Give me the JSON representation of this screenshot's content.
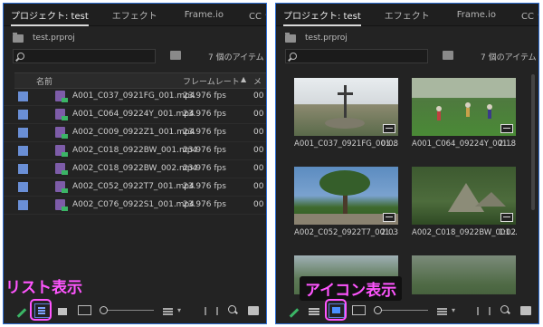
{
  "tabs": {
    "project": "プロジェクト: test",
    "effects": "エフェクト",
    "frameio": "Frame.io",
    "cclib": "CC ライ"
  },
  "project_file": "test.prproj",
  "search": {
    "placeholder": ""
  },
  "item_count": "7 個のアイテム",
  "list_view": {
    "columns": {
      "name": "名前",
      "framerate": "フレームレート",
      "extra": "メ"
    },
    "rows": [
      {
        "name": "A001_C037_0921FG_001.mp4",
        "fps": "23.976 fps",
        "extra": "00"
      },
      {
        "name": "A001_C064_09224Y_001.mp4",
        "fps": "23.976 fps",
        "extra": "00"
      },
      {
        "name": "A002_C009_0922Z1_001.mp4",
        "fps": "23.976 fps",
        "extra": "00"
      },
      {
        "name": "A002_C018_0922BW_001.mp4",
        "fps": "23.976 fps",
        "extra": "00"
      },
      {
        "name": "A002_C018_0922BW_002.mp4",
        "fps": "23.976 fps",
        "extra": "00"
      },
      {
        "name": "A002_C052_0922T7_001.mp4",
        "fps": "23.976 fps",
        "extra": "00"
      },
      {
        "name": "A002_C076_0922S1_001.mp4",
        "fps": "23.976 fps",
        "extra": "00"
      }
    ]
  },
  "icon_view": {
    "clips": [
      {
        "name": "A001_C037_0921FG_001...",
        "dur": "0:08"
      },
      {
        "name": "A001_C064_09224Y_001...",
        "dur": "2:18"
      },
      {
        "name": "A002_C052_0922T7_001...",
        "dur": "2:03"
      },
      {
        "name": "A002_C018_0922BW_001...",
        "dur": "1:02"
      },
      {
        "name": "",
        "dur": ""
      },
      {
        "name": "",
        "dur": ""
      }
    ]
  },
  "callouts": {
    "list": "リスト表示",
    "icon": "アイコン表示"
  },
  "colors": {
    "highlight": "#ff55ff",
    "accent": "#2f6fd4"
  }
}
